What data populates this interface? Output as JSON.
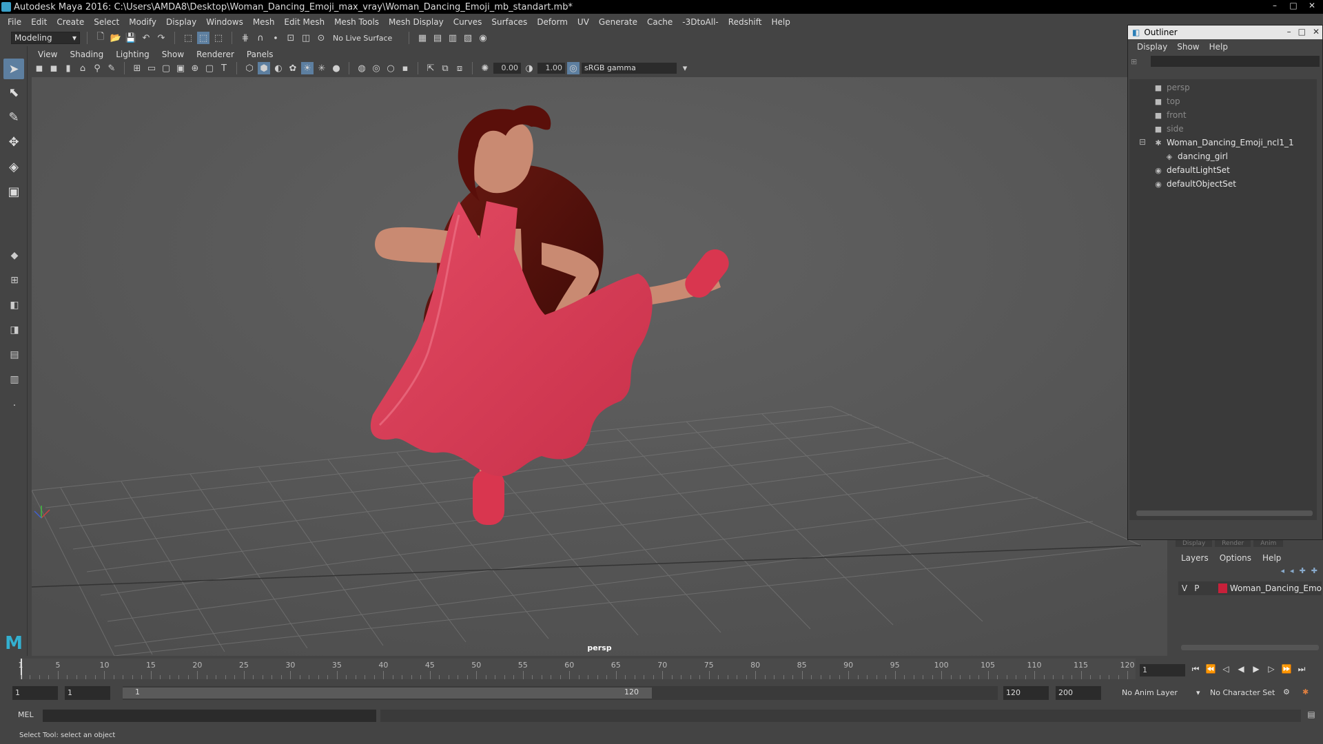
{
  "window": {
    "title": "Autodesk Maya 2016: C:\\Users\\AMDA8\\Desktop\\Woman_Dancing_Emoji_max_vray\\Woman_Dancing_Emoji_mb_standart.mb*",
    "controls": [
      "–",
      "□",
      "✕"
    ]
  },
  "menubar": [
    "File",
    "Edit",
    "Create",
    "Select",
    "Modify",
    "Display",
    "Windows",
    "Mesh",
    "Edit Mesh",
    "Mesh Tools",
    "Mesh Display",
    "Curves",
    "Surfaces",
    "Deform",
    "UV",
    "Generate",
    "Cache",
    "-3DtoAll-",
    "Redshift",
    "Help"
  ],
  "statusline": {
    "menuset": "Modeling",
    "live_surface": "No Live Surface"
  },
  "panel": {
    "menus": [
      "View",
      "Shading",
      "Lighting",
      "Show",
      "Renderer",
      "Panels"
    ],
    "exposure": "0.00",
    "gamma": "1.00",
    "color_space": "sRGB gamma",
    "camera": "persp"
  },
  "outliner": {
    "title": "Outliner",
    "menus": [
      "Display",
      "Show",
      "Help"
    ],
    "items": [
      {
        "label": "persp",
        "icon": "camera-icon",
        "dim": true
      },
      {
        "label": "top",
        "icon": "camera-icon",
        "dim": true
      },
      {
        "label": "front",
        "icon": "camera-icon",
        "dim": true
      },
      {
        "label": "side",
        "icon": "camera-icon",
        "dim": true
      },
      {
        "label": "Woman_Dancing_Emoji_ncl1_1",
        "icon": "group-icon",
        "dim": false
      },
      {
        "label": "dancing_girl",
        "icon": "mesh-icon",
        "dim": false
      },
      {
        "label": "defaultLightSet",
        "icon": "set-icon",
        "dim": false
      },
      {
        "label": "defaultObjectSet",
        "icon": "set-icon",
        "dim": false
      }
    ]
  },
  "layer_editor": {
    "tabs": [
      "Display",
      "Render",
      "Anim"
    ],
    "menus": [
      "Layers",
      "Options",
      "Help"
    ],
    "layer": {
      "v": "V",
      "p": "P",
      "name": "Woman_Dancing_Emo",
      "color": "#c8203a"
    }
  },
  "timeline": {
    "ticks": [
      "5",
      "10",
      "15",
      "20",
      "25",
      "30",
      "35",
      "40",
      "45",
      "50",
      "55",
      "60",
      "65",
      "70",
      "75",
      "80",
      "85",
      "90",
      "95",
      "100",
      "105",
      "110",
      "115",
      "120"
    ],
    "start_marker": "1",
    "current_frame": "1"
  },
  "range": {
    "start": "1",
    "playback_start": "1",
    "slider_start": "1",
    "slider_end": "120",
    "playback_end": "120",
    "end": "200",
    "anim_layer": "No Anim Layer",
    "character_set": "No Character Set"
  },
  "cmdline": {
    "label": "MEL"
  },
  "helpline": {
    "text": "Select Tool: select an object"
  },
  "colors": {
    "dress": "#d9364f",
    "skin": "#c98a72",
    "hair": "#4a0c08",
    "viewport": "#5a5a5a",
    "accent": "#5d7fa0"
  }
}
